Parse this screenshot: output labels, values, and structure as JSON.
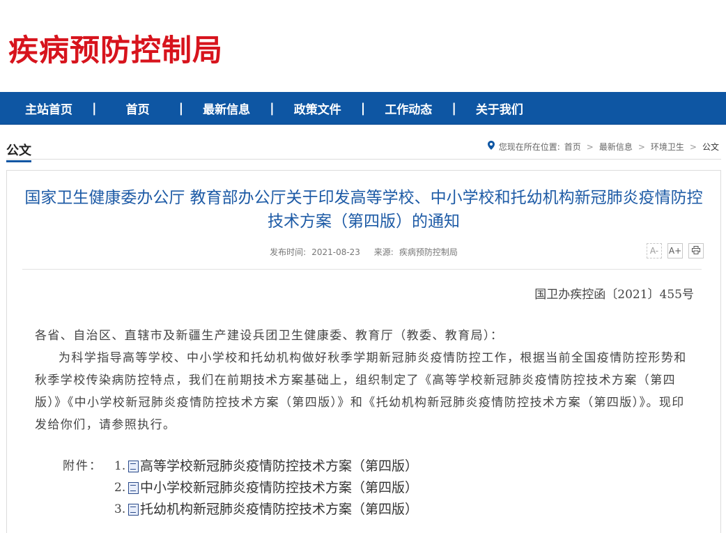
{
  "site": {
    "title": "疾病预防控制局"
  },
  "nav": {
    "items": [
      "主站首页",
      "首页",
      "最新信息",
      "政策文件",
      "工作动态",
      "关于我们"
    ],
    "separator": "|"
  },
  "section": {
    "title": "公文"
  },
  "breadcrumb": {
    "prefix": "您现在所在位置:",
    "items": [
      "首页",
      "最新信息",
      "环境卫生",
      "公文"
    ],
    "arrow": ">"
  },
  "article": {
    "title": "国家卫生健康委办公厅 教育部办公厅关于印发高等学校、中小学校和托幼机构新冠肺炎疫情防控技术方案（第四版）的通知",
    "publish_label": "发布时间:",
    "publish_date": "2021-08-23",
    "source_label": "来源:",
    "source": "疾病预防控制局",
    "tools": {
      "font_smaller": "A-",
      "font_larger": "A+",
      "print_icon": "print-icon"
    },
    "doc_number": "国卫办疾控函〔2021〕455号",
    "salutation": "各省、自治区、直辖市及新疆生产建设兵团卫生健康委、教育厅（教委、教育局）：",
    "paragraph": "为科学指导高等学校、中小学校和托幼机构做好秋季学期新冠肺炎疫情防控工作，根据当前全国疫情防控形势和秋季学校传染病防控特点，我们在前期技术方案基础上，组织制定了《高等学校新冠肺炎疫情防控技术方案（第四版）》《中小学校新冠肺炎疫情防控技术方案（第四版）》和《托幼机构新冠肺炎疫情防控技术方案（第四版）》。现印发给你们，请参照执行。",
    "attachments_label": "附件：",
    "attachments": [
      {
        "num": "1.",
        "title": "高等学校新冠肺炎疫情防控技术方案（第四版）"
      },
      {
        "num": "2.",
        "title": "中小学校新冠肺炎疫情防控技术方案（第四版）"
      },
      {
        "num": "3.",
        "title": "托幼机构新冠肺炎疫情防控技术方案（第四版）"
      }
    ]
  },
  "colors": {
    "brand_red": "#d7141d",
    "nav_blue": "#0e56a3",
    "title_blue": "#1e5ba6"
  }
}
